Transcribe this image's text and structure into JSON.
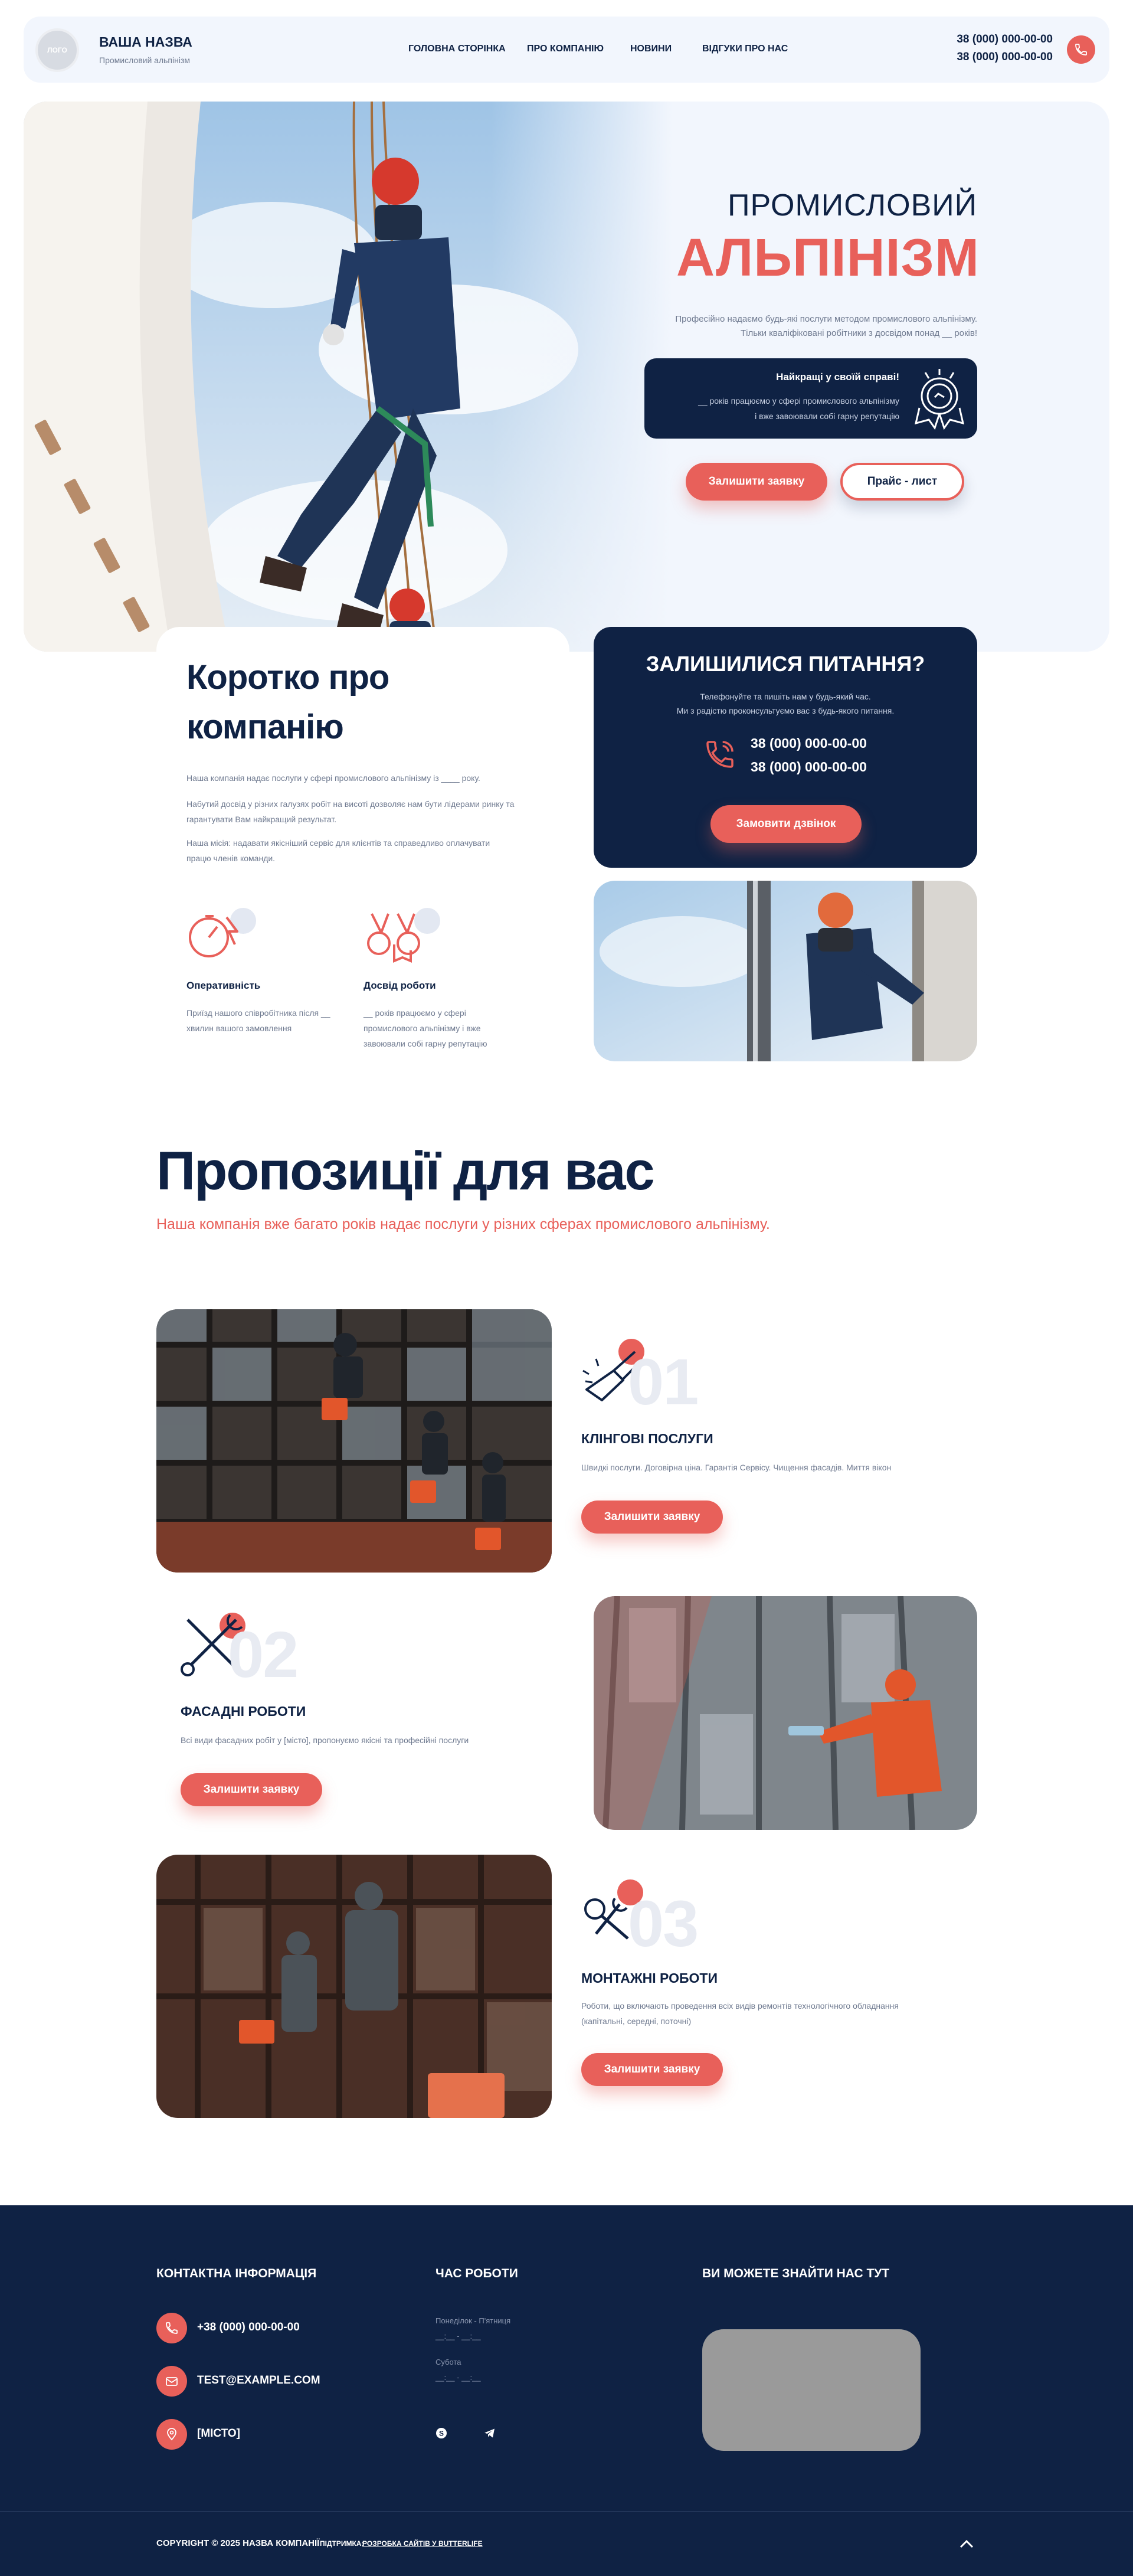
{
  "header": {
    "logo_text": "ЛОГО",
    "company_name": "ВАША НАЗВА",
    "tagline": "Промисловий альпінізм",
    "nav": [
      "ГОЛОВНА СТОРІНКА",
      "ПРО КОМПАНІЮ",
      "НОВИНИ",
      "ВІДГУКИ ПРО НАС"
    ],
    "phone1": "38 (000) 000-00-00",
    "phone2": "38 (000) 000-00-00"
  },
  "hero": {
    "title_light": "ПРОМИСЛОВИЙ",
    "title_bold": "АЛЬПІНІЗМ",
    "desc_line1": "Професійно надаємо будь-які послуги методом промислового альпінізму.",
    "desc_line2": "Тільки кваліфіковані робітники з досвідом понад __ років!",
    "badge_title": "Найкращі у своїй справі!",
    "badge_line1": "__ років працюємо у сфері промислового альпінізму",
    "badge_line2": "і вже завоювали собі гарну репутацію",
    "btn_request": "Залишити заявку",
    "btn_price": "Прайс - лист"
  },
  "about": {
    "title_line1": "Коротко про",
    "title_line2": "компанію",
    "p1": "Наша компанія надає послуги у сфері промислового альпінізму із ____ року.",
    "p2_line1": "Набутий досвід у різних галузях робіт на висоті дозволяє нам бути лідерами ринку та",
    "p2_line2": "гарантувати Вам найкращий результат.",
    "p3_line1": "Наша місія: надавати якісніший сервіс для клієнтів та справедливо оплачувати",
    "p3_line2": "працю членів команди.",
    "feature1_title": "Оперативність",
    "feature1_line1": "Приїзд нашого співробітника після __",
    "feature1_line2": "хвилин вашого замовлення",
    "feature2_title": "Досвід роботи",
    "feature2_line1": "__ років працюємо у сфері",
    "feature2_line2": "промислового альпінізму і вже",
    "feature2_line3": "завоювали собі гарну репутацію"
  },
  "questions": {
    "title": "ЗАЛИШИЛИСЯ ПИТАННЯ?",
    "line1": "Телефонуйте та пишіть нам у будь-який час.",
    "line2": "Ми з радістю проконсультуємо вас з будь-якого питання.",
    "phone1": "38 (000) 000-00-00",
    "phone2": "38 (000) 000-00-00",
    "btn": "Замовити дзвінок"
  },
  "offers": {
    "title": "Пропозиції для вас",
    "subtitle": "Наша компанія вже багато років надає послуги у різних сферах промислового альпінізму.",
    "items": [
      {
        "num": "01",
        "title": "КЛІНГОВІ ПОСЛУГИ",
        "desc_line1": "Швидкі послуги. Договірна ціна. Гарантія Сервісу. Чищення фасадів. Миття вікон",
        "desc_line2": "",
        "btn": "Залишити заявку"
      },
      {
        "num": "02",
        "title": "ФАСАДНІ РОБОТИ",
        "desc_line1": "Всі види фасадних робіт у [місто], пропонуємо якісні та професійні послуги",
        "desc_line2": "",
        "btn": "Залишити заявку"
      },
      {
        "num": "03",
        "title": "МОНТАЖНІ РОБОТИ",
        "desc_line1": "Роботи, що включають проведення всіх видів ремонтів технологічного обладнання",
        "desc_line2": "(капітальні, середні, поточні)",
        "btn": "Залишити заявку"
      }
    ]
  },
  "footer": {
    "contacts_title": "КОНТАКТНА ІНФОРМАЦІЯ",
    "phone": "+38 (000) 000-00-00",
    "email": "TEST@EXAMPLE.COM",
    "city": "[МІСТО]",
    "hours_title": "ЧАС РОБОТИ",
    "weekdays": "Понеділок - П'ятниця",
    "weekdays_time": "__:__ - __:__",
    "saturday": "Субота",
    "saturday_time": "__:__ - __:__",
    "find_title": "ВИ МОЖЕТЕ ЗНАЙТИ НАС ТУТ",
    "copyright": "COPYRIGHT © 2025 НАЗВА КОМПАНІЇ",
    "support_prefix": "ПІДТРИМКА:",
    "support_link": "РОЗРОБКА САЙТІВ У BUTTERLIFE"
  },
  "colors": {
    "navy": "#0f2244",
    "coral": "#e8605a",
    "light_bg": "#f2f6fd"
  },
  "icons": [
    "phone-icon",
    "email-icon",
    "location-icon",
    "skype-icon",
    "telegram-icon",
    "arrow-up-icon",
    "award-icon",
    "stopwatch-icon",
    "medal-icon",
    "cleaning-icon",
    "tools-icon"
  ]
}
